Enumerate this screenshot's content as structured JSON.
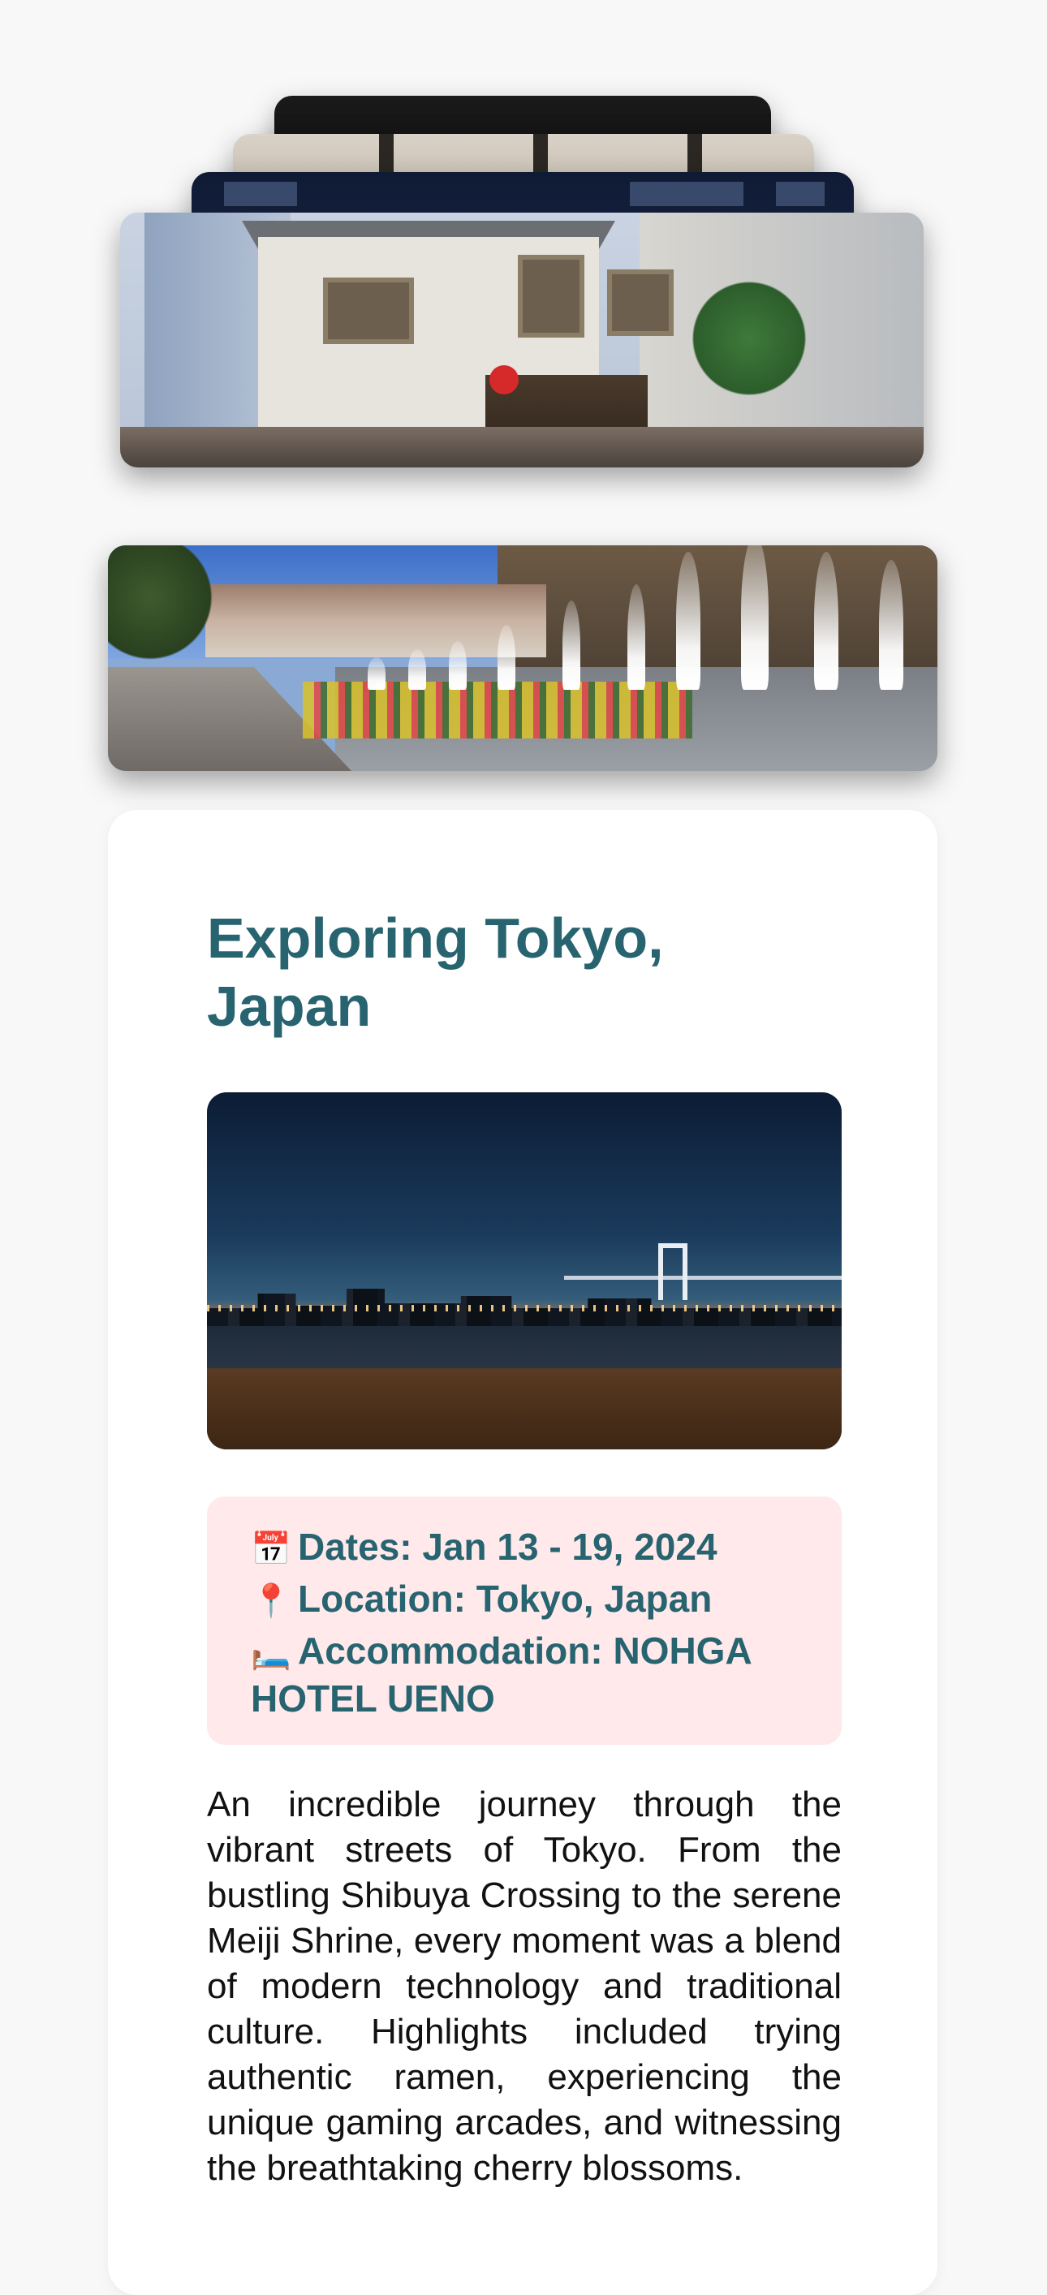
{
  "post": {
    "title": "Exploring Tokyo, Japan",
    "details": {
      "dates_icon": "calendar-icon",
      "dates_label": "Dates: Jan 13 - 19, 2024",
      "location_icon": "round-pushpin-icon",
      "location_label": "Location: Tokyo, Japan",
      "accommodation_icon": "bed-icon",
      "accommodation_label": "Accommodation: NOHGA HOTEL UENO"
    },
    "description": "An incredible journey through the vibrant streets of Tokyo. From the bustling Shibuya Crossing to the serene Meiji Shrine, every moment was a blend of modern technology and traditional culture. Highlights included trying authentic ramen, experiencing the unique gaming arcades, and witnessing the breathtaking cherry blossoms."
  },
  "colors": {
    "accent": "#276470",
    "info_background": "#ffe9ea",
    "page_background": "#f8f8f8"
  }
}
